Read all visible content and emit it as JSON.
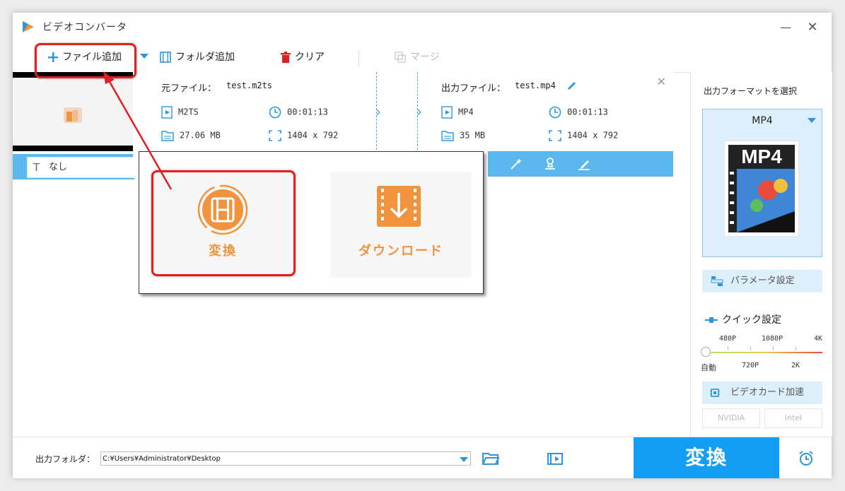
{
  "window": {
    "title": "ビデオコンバータ",
    "minimize": "—",
    "close": "✕"
  },
  "toolbar": {
    "add_file": "ファイル追加",
    "add_folder": "フォルダ追加",
    "clear": "クリア",
    "merge": "マージ"
  },
  "file": {
    "source_label": "元ファイル：",
    "source_name": "test.m2ts",
    "output_label": "出力ファイル：",
    "output_name": "test.mp4",
    "source_format": "M2TS",
    "source_duration": "00:01:13",
    "source_size": "27.06 MB",
    "source_resolution": "1404 x 792",
    "output_format": "MP4",
    "output_duration": "00:01:13",
    "output_size": "35 MB",
    "output_resolution": "1404 x 792",
    "subtitle": "なし"
  },
  "popup": {
    "convert": "変換",
    "download": "ダウンロード"
  },
  "right_panel": {
    "title": "出力フォーマットを選択",
    "format": "MP4",
    "format_image_label": "MP4",
    "param_settings": "パラメータ設定",
    "quick_settings": "クイック設定",
    "quality_top": [
      "480P",
      "1080P",
      "4K"
    ],
    "quality_bottom": [
      "自動",
      "720P",
      "2K"
    ],
    "gpu": "ビデオカード加速",
    "gpu_nvidia": "NVIDIA",
    "gpu_intel": "Intel"
  },
  "bottom": {
    "output_folder_label": "出力フォルダ：",
    "output_path": "C:¥Users¥Administrator¥Desktop",
    "convert": "変換"
  },
  "colors": {
    "accent": "#139ef4",
    "orange": "#f0933c",
    "highlight": "#e02020"
  }
}
